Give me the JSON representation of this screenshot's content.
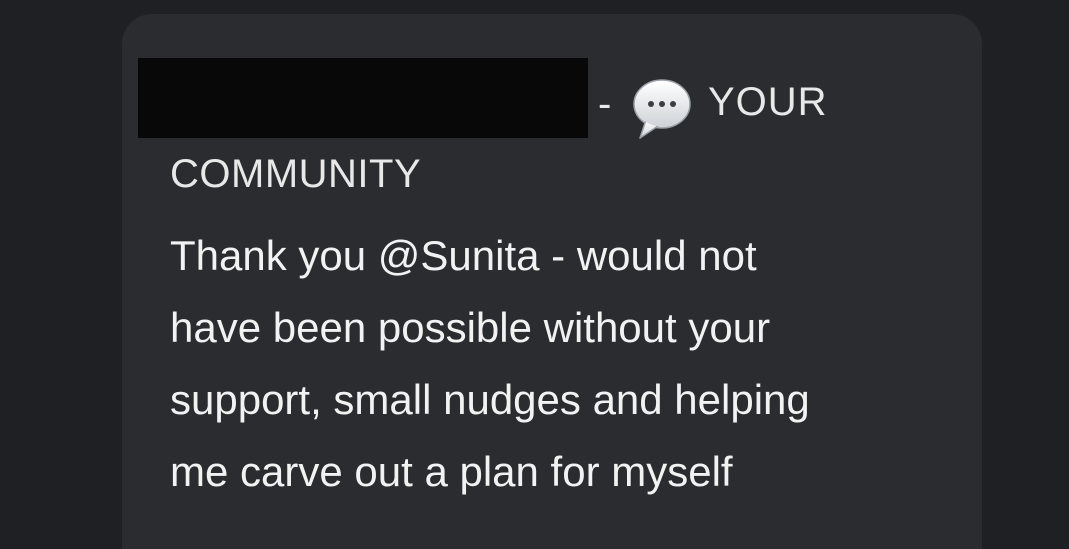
{
  "post": {
    "header_separator": "-",
    "header_icon": "speech-bubble-icon",
    "header_label_line1": "YOUR",
    "header_label_line2": "COMMUNITY",
    "message_lines": [
      "Thank you @Sunita - would not",
      "have been possible without your",
      "support, small nudges and helping",
      "me carve out a plan for myself"
    ]
  },
  "colors": {
    "page_background": "#1f2023",
    "card_background": "#2b2c2f",
    "redaction": "#080808",
    "text": "#f2f2f2"
  }
}
